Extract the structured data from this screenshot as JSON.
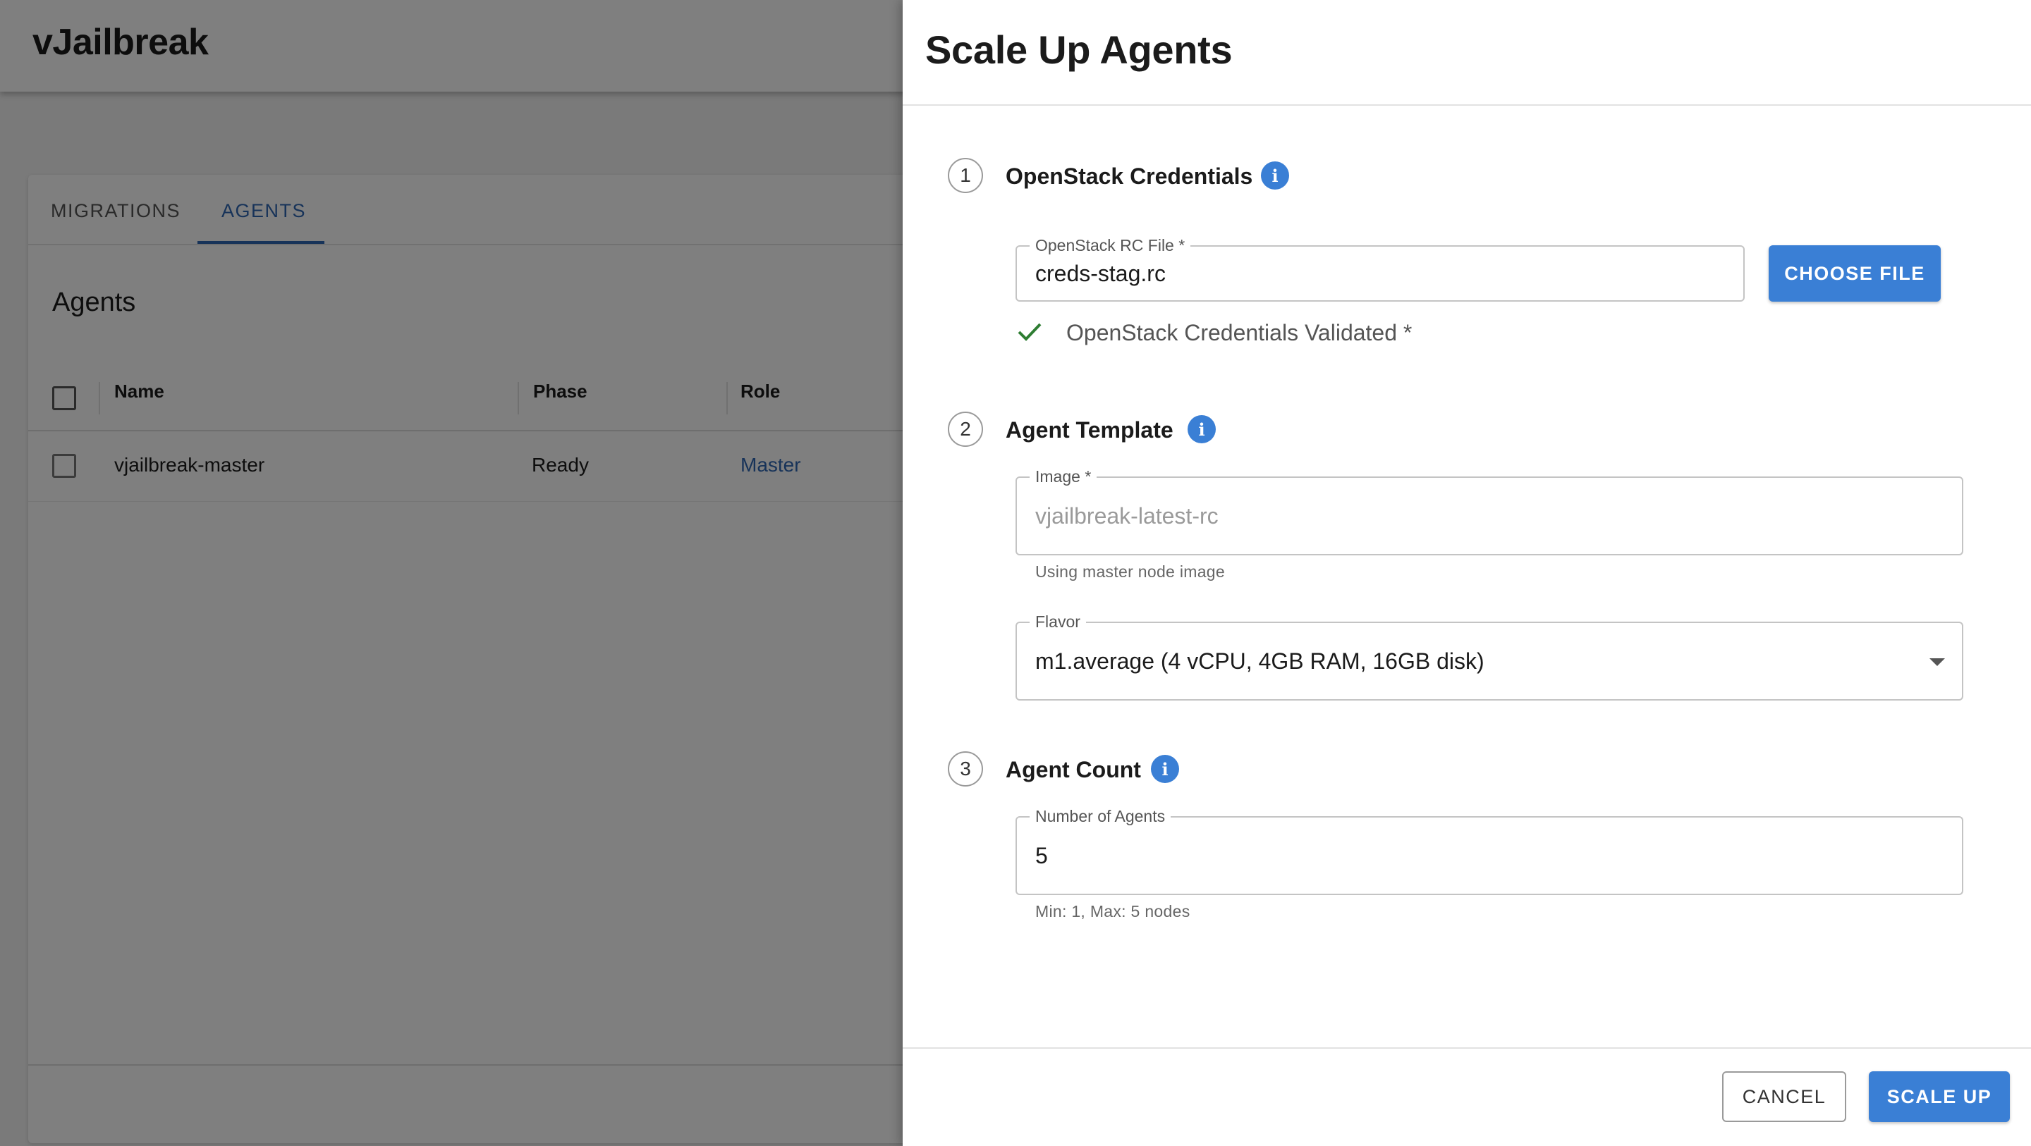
{
  "app": {
    "brand": "vJailbreak",
    "tabs": [
      {
        "label": "MIGRATIONS",
        "active": false
      },
      {
        "label": "AGENTS",
        "active": true
      }
    ],
    "section_title": "Agents",
    "table": {
      "columns": [
        "Name",
        "Phase",
        "Role"
      ],
      "rows": [
        {
          "name": "vjailbreak-master",
          "phase": "Ready",
          "role": "Master"
        }
      ]
    }
  },
  "drawer": {
    "title": "Scale Up Agents",
    "steps": [
      {
        "number": "1",
        "title": "OpenStack Credentials"
      },
      {
        "number": "2",
        "title": "Agent Template"
      },
      {
        "number": "3",
        "title": "Agent Count"
      }
    ],
    "credentials": {
      "label": "OpenStack RC File *",
      "value": "creds-stag.rc",
      "choose_button": "CHOOSE FILE",
      "validated_text": "OpenStack Credentials Validated *"
    },
    "template": {
      "image_label": "Image *",
      "image_value": "vjailbreak-latest-rc",
      "image_helper": "Using master node image",
      "flavor_label": "Flavor",
      "flavor_value": "m1.average (4 vCPU, 4GB RAM, 16GB disk)"
    },
    "count": {
      "label": "Number of Agents",
      "value": "5",
      "helper": "Min: 1, Max: 5 nodes"
    },
    "buttons": {
      "cancel": "CANCEL",
      "scale_up": "SCALE UP"
    }
  },
  "colors": {
    "primary": "#3a7fd5",
    "link": "#2f66b3",
    "success": "#2e7d32",
    "overlay": "rgba(0,0,0,0.5)"
  },
  "icons": [
    "info-icon",
    "check-icon",
    "chevron-down-icon"
  ]
}
